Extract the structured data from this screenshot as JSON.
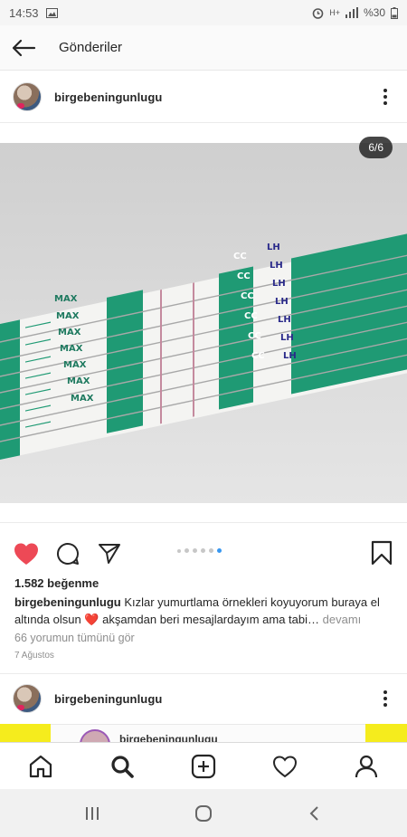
{
  "status_bar": {
    "time": "14:53",
    "battery": "%30"
  },
  "header": {
    "title": "Gönderiler"
  },
  "post": {
    "username": "birgebeningunlugu",
    "counter": "6/6",
    "likes": "1.582 beğenme",
    "caption_user": "birgebeningunlugu",
    "caption_text": " Kızlar yumurtlama örnekleri koyuyorum buraya el altında olsun ❤️ akşamdan beri mesajlardayım ama tabi…",
    "caption_more": " devamı",
    "comments_link": "66 yorumun tümünü gör",
    "date": "7 Ağustos",
    "photo_labels": {
      "max": "MAX",
      "lh": "LH",
      "cc": "CC"
    }
  },
  "next_post": {
    "username": "birgebeningunlugu",
    "peek_username": "birgebeningunlugu"
  },
  "colors": {
    "like_red": "#ed4956",
    "active_dot": "#3897f0",
    "strip_green": "#1f9a74",
    "yellow": "#f5ec1d"
  }
}
